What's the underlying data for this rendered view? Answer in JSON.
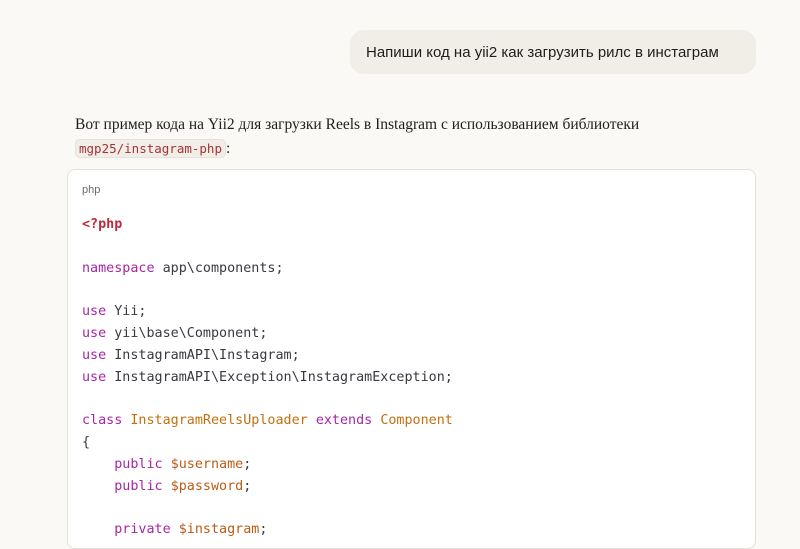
{
  "user_message": "Напиши код на yii2 как загрузить рилс в инстаграм",
  "assistant": {
    "intro": "Вот пример кода на Yii2 для загрузки Reels в Instagram с использованием библиотеки",
    "library": "mgp25/instagram-php",
    "suffix": ":"
  },
  "code_block": {
    "language": "php",
    "lines": [
      [
        {
          "t": "<?php",
          "c": "tag"
        }
      ],
      [],
      [
        {
          "t": "namespace",
          "c": "kw"
        },
        {
          "t": " app\\components;",
          "c": ""
        }
      ],
      [],
      [
        {
          "t": "use",
          "c": "kw"
        },
        {
          "t": " Yii;",
          "c": ""
        }
      ],
      [
        {
          "t": "use",
          "c": "kw"
        },
        {
          "t": " yii\\base\\Component;",
          "c": ""
        }
      ],
      [
        {
          "t": "use",
          "c": "kw"
        },
        {
          "t": " InstagramAPI\\Instagram;",
          "c": ""
        }
      ],
      [
        {
          "t": "use",
          "c": "kw"
        },
        {
          "t": " InstagramAPI\\Exception\\InstagramException;",
          "c": ""
        }
      ],
      [],
      [
        {
          "t": "class",
          "c": "kw"
        },
        {
          "t": " ",
          "c": ""
        },
        {
          "t": "InstagramReelsUploader",
          "c": "cls"
        },
        {
          "t": " ",
          "c": ""
        },
        {
          "t": "extends",
          "c": "kw"
        },
        {
          "t": " ",
          "c": ""
        },
        {
          "t": "Component",
          "c": "cls"
        }
      ],
      [
        {
          "t": "{",
          "c": ""
        }
      ],
      [
        {
          "t": "    ",
          "c": ""
        },
        {
          "t": "public",
          "c": "kw"
        },
        {
          "t": " ",
          "c": ""
        },
        {
          "t": "$username",
          "c": "var"
        },
        {
          "t": ";",
          "c": ""
        }
      ],
      [
        {
          "t": "    ",
          "c": ""
        },
        {
          "t": "public",
          "c": "kw"
        },
        {
          "t": " ",
          "c": ""
        },
        {
          "t": "$password",
          "c": "var"
        },
        {
          "t": ";",
          "c": ""
        }
      ],
      [],
      [
        {
          "t": "    ",
          "c": ""
        },
        {
          "t": "private",
          "c": "kw"
        },
        {
          "t": " ",
          "c": ""
        },
        {
          "t": "$instagram",
          "c": "var"
        },
        {
          "t": ";",
          "c": ""
        }
      ]
    ]
  }
}
